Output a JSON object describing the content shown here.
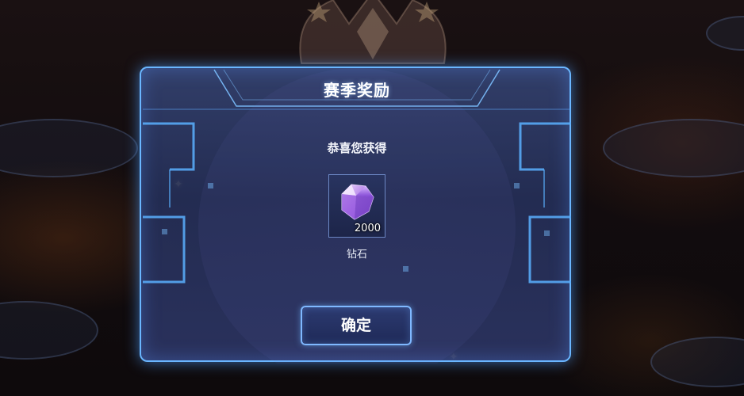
{
  "dialog": {
    "title": "赛季奖励",
    "subtitle": "恭喜您获得",
    "confirm_label": "确定"
  },
  "reward": {
    "icon": "diamond-icon",
    "quantity": "2000",
    "name": "钻石"
  },
  "colors": {
    "frame_glow": "#6ab6ff",
    "panel_fill": "#34426f",
    "gem_purple": "#b07ae8"
  }
}
